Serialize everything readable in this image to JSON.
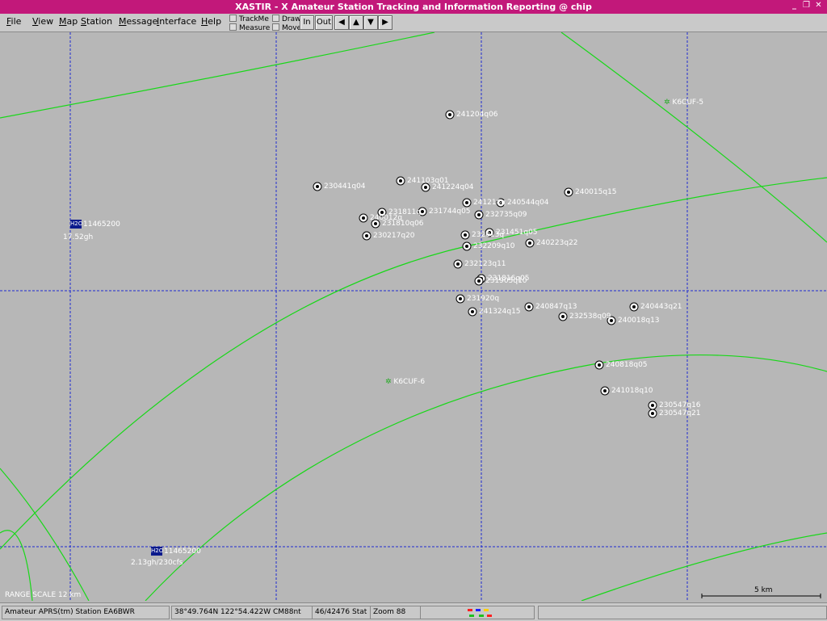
{
  "window": {
    "title": "XASTIR - X Amateur Station Tracking and Information Reporting @ chip",
    "buttons": [
      "_",
      "❐",
      "✕"
    ]
  },
  "menu": [
    "File",
    "View",
    "Map",
    "Station",
    "Message",
    "Interface",
    "Help"
  ],
  "toolbar": {
    "checks": [
      "TrackMe",
      "Measure",
      "Draw",
      "Move"
    ],
    "zoom_in": "In",
    "zoom_out": "Out",
    "arrows": [
      "◀",
      "▲",
      "▼",
      "▶"
    ]
  },
  "map": {
    "range_scale": "RANGE SCALE 12 km",
    "scale_bar_label": "5 km",
    "grid_color": "#1f2bd0",
    "track_color": "#18d818",
    "digipeaters": [
      {
        "label": "K6CUF-5"
      },
      {
        "label": "K6CUF-6"
      }
    ],
    "weather": [
      {
        "symbol": "H2O",
        "label": "11465200",
        "sub": "17.52gh"
      },
      {
        "symbol": "H2O",
        "label": "11465200",
        "sub": "2.13gh/230cfs"
      }
    ],
    "stations": [
      "241204q06",
      "230441q04",
      "241103q01",
      "241224q04",
      "240015q15",
      "240544q04",
      "231811q",
      "231744q05",
      "232735q09",
      "231810q06",
      "230217q20",
      "240223q22",
      "231451q05",
      "232209q10",
      "232123q11",
      "231816q05",
      "231905q10",
      "231920q",
      "240847q13",
      "232538q09",
      "240443q21",
      "241324q15",
      "240018q13",
      "240818q05",
      "241018q10",
      "230547q16",
      "230547q21",
      "240012q",
      "241218q",
      "232013q"
    ]
  },
  "status": {
    "station": "Amateur APRS(tm) Station EA6BWR",
    "coords": "38°49.764N  122°54.422W  CM88nt",
    "stats": "46/42476 Stat",
    "zoom": "Zoom 88",
    "indicator_colors": [
      "#ff2020",
      "#2020ff",
      "#ffd000",
      "#20c020",
      "#20c020",
      "#ff2020"
    ]
  }
}
